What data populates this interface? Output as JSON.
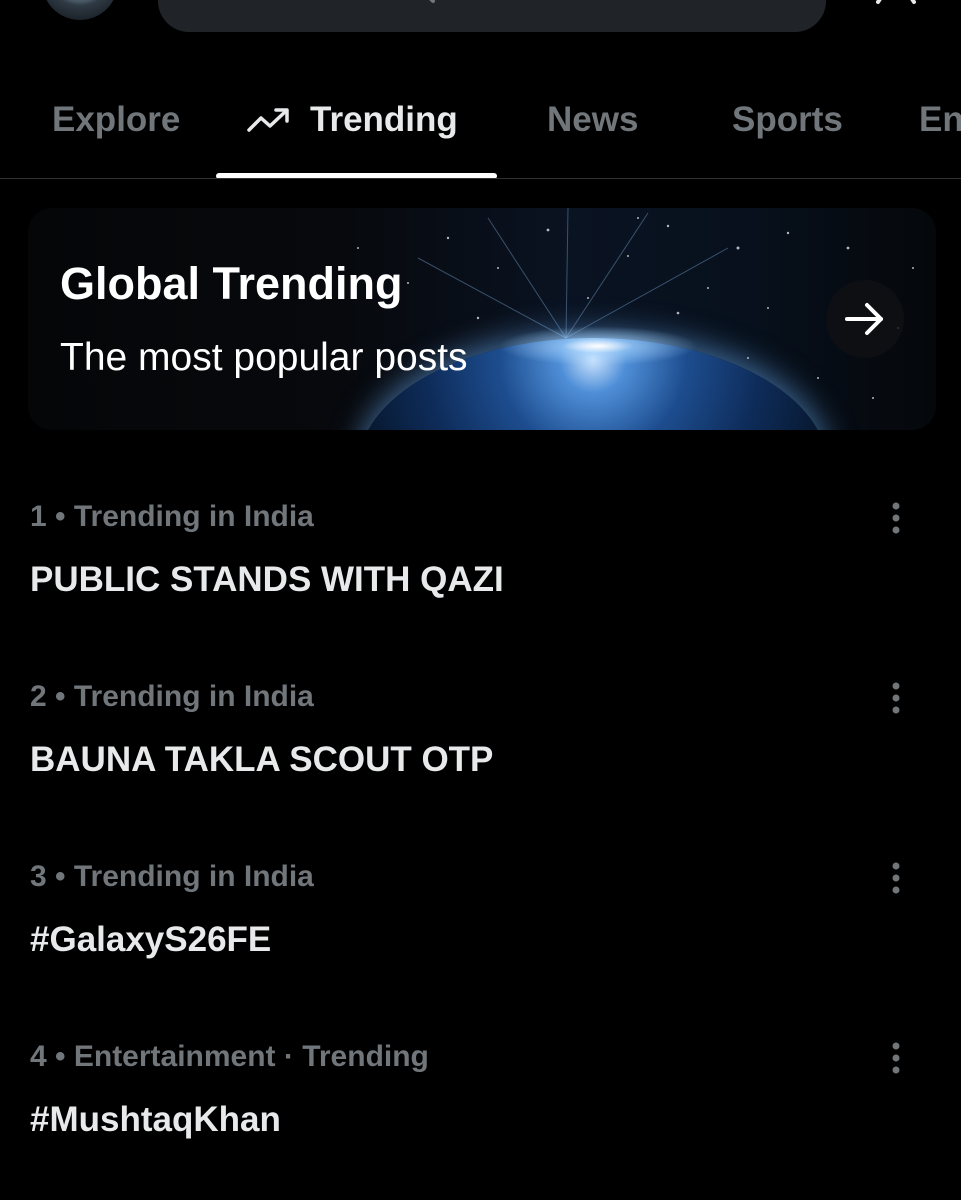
{
  "tabs": [
    {
      "label": "Explore"
    },
    {
      "label": "Trending"
    },
    {
      "label": "News"
    },
    {
      "label": "Sports"
    },
    {
      "label": "En"
    }
  ],
  "banner": {
    "title": "Global Trending",
    "subtitle": "The most popular posts"
  },
  "trends": [
    {
      "meta": "1 • Trending in India",
      "title": "PUBLIC STANDS WITH QAZI"
    },
    {
      "meta": "2 • Trending in India",
      "title": "BAUNA TAKLA SCOUT OTP"
    },
    {
      "meta": "3 • Trending in India",
      "title": "#GalaxyS26FE"
    },
    {
      "meta": "4 • Entertainment · Trending",
      "title": "#MushtaqKhan"
    }
  ],
  "icons": {
    "tab_trending": "trending-arrow-icon",
    "banner_arrow": "arrow-right-icon",
    "more": "more-vertical-icon",
    "search": "search-icon",
    "settings": "gear-icon"
  },
  "colors": {
    "background": "#000000",
    "primary_text": "#e7e9ea",
    "secondary_text": "#71767b",
    "divider": "#2f3336",
    "search_pill": "#202327"
  }
}
